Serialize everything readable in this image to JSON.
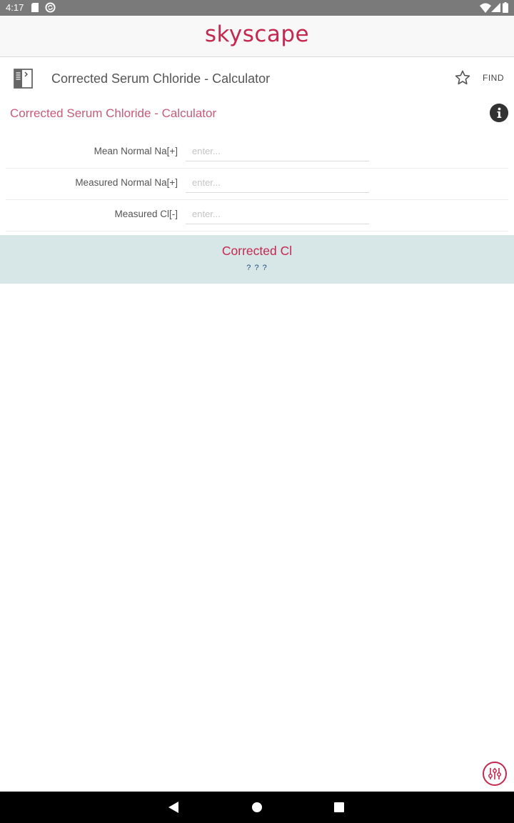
{
  "status_bar": {
    "time": "4:17",
    "icons": [
      "sd-card-icon",
      "sync-icon",
      "wifi-icon",
      "signal-icon",
      "battery-icon"
    ]
  },
  "app_bar": {
    "brand": "skyscape",
    "brand_color": "#c5284f"
  },
  "title_bar": {
    "title": "Corrected Serum Chloride - Calculator",
    "find_label": "FIND",
    "icons": [
      "table-of-contents-icon",
      "star-icon"
    ]
  },
  "calculator": {
    "title": "Corrected Serum Chloride - Calculator",
    "title_color": "#c95a78",
    "fields": [
      {
        "label": "Mean Normal Na[+]",
        "value": "",
        "placeholder": "enter..."
      },
      {
        "label": "Measured Normal Na[+]",
        "value": "",
        "placeholder": "enter..."
      },
      {
        "label": "Measured Cl[-]",
        "value": "",
        "placeholder": "enter..."
      }
    ],
    "result": {
      "label": "Corrected Cl",
      "value": "? ? ?",
      "background": "#d7e6e7"
    }
  },
  "fab": {
    "icon": "sliders-icon"
  },
  "nav_bar": {
    "icons": [
      "back-icon",
      "home-icon",
      "recents-icon"
    ]
  }
}
